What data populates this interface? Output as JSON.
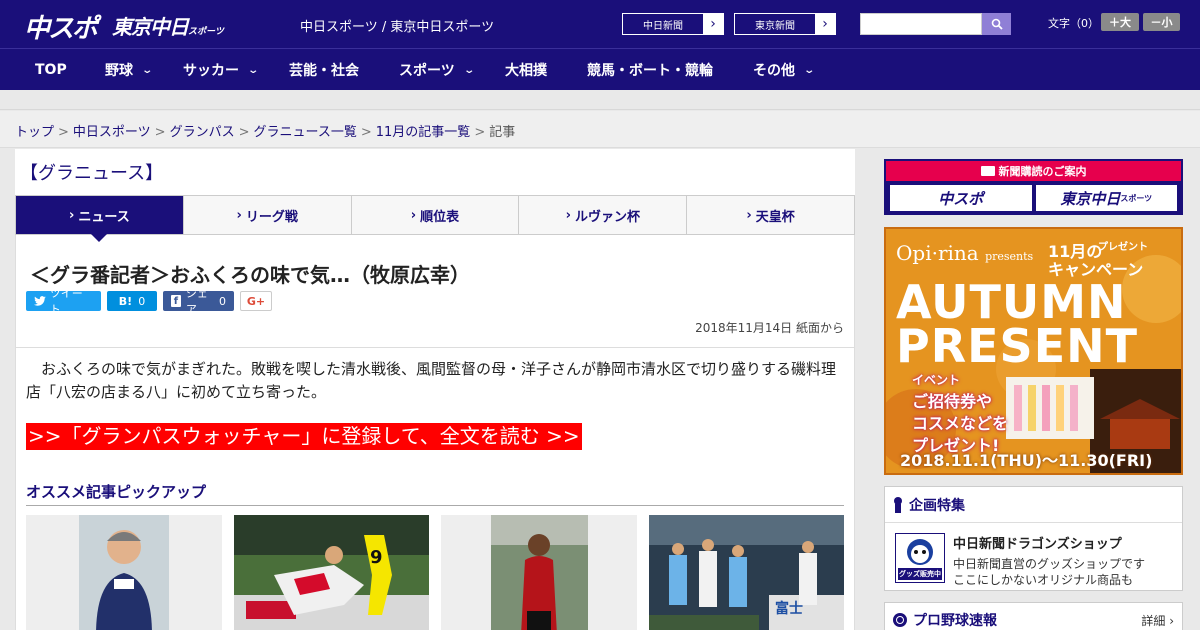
{
  "header": {
    "logo_chu": "中スポ",
    "logo_tokyo": "東京中日",
    "logo_tokyo_sub": "スポーツ",
    "tagline": "中日スポーツ / 東京中日スポーツ",
    "ext_links": [
      "中日新聞",
      "東京新聞"
    ],
    "search_placeholder": "",
    "font_size_label": "文字（0）",
    "font_up": "＋大",
    "font_down": "－小"
  },
  "nav": {
    "items": [
      {
        "label": "TOP",
        "dropdown": false
      },
      {
        "label": "野球",
        "dropdown": true
      },
      {
        "label": "サッカー",
        "dropdown": true
      },
      {
        "label": "芸能・社会",
        "dropdown": false
      },
      {
        "label": "スポーツ",
        "dropdown": true
      },
      {
        "label": "大相撲",
        "dropdown": false
      },
      {
        "label": "競馬・ボート・競輪",
        "dropdown": false
      },
      {
        "label": "その他",
        "dropdown": true
      }
    ]
  },
  "breadcrumb": {
    "items": [
      "トップ",
      "中日スポーツ",
      "グランパス",
      "グラニュース一覧",
      "11月の記事一覧"
    ],
    "current": "記事",
    "sep": ">"
  },
  "main": {
    "section_title": "【グラニュース】",
    "tabs": [
      "ニュース",
      "リーグ戦",
      "順位表",
      "ルヴァン杯",
      "天皇杯"
    ],
    "tab_marker": "›",
    "article": {
      "title": "＜グラ番記者＞おふくろの味で気…（牧原広幸）",
      "share": {
        "tweet": "ツイート",
        "hatena": "B!",
        "hatena_count": "0",
        "facebook": "シェア",
        "facebook_count": "0",
        "gplus": "G+"
      },
      "date": "2018年11月14日 紙面から",
      "lead": "おふくろの味で気がまぎれた。敗戦を喫した清水戦後、風間監督の母・洋子さんが静岡市清水区で切り盛りする磯料理店「八宏の店まる八」に初めて立ち寄った。",
      "cta": ">>「グランパスウォッチャー」に登録して、全文を読む >>"
    },
    "pickup_title": "オススメ記事ピックアップ"
  },
  "sidebar": {
    "subscribe_title": "新聞購読のご案内",
    "subscribe_chu": "中スポ",
    "subscribe_tokyo": "東京中日",
    "subscribe_tokyo_sub": "スポーツ",
    "ad": {
      "brand": "Opi·rina",
      "presents": "presents",
      "campaign_line1": "11月の",
      "campaign_line2": "キャンペーン",
      "campaign_small": "プレゼント",
      "big1": "AUTUMN",
      "big2": "PRESENT",
      "promo1": "イベント",
      "promo2": "ご招待券や",
      "promo3": "コスメなどを",
      "promo4": "プレゼント!",
      "period": "2018.11.1(THU)～11.30(FRI)"
    },
    "feature_title": "企画特集",
    "shop_title": "中日新聞ドラゴンズショップ",
    "shop_desc1": "中日新聞直営のグッズショップです",
    "shop_desc2": "ここにしかないオリジナル商品も",
    "shop_badge": "グッズ販売中",
    "baseball_title": "プロ野球速報",
    "baseball_more": "詳細 ›"
  },
  "colors": {
    "brand_navy": "#1a0f7a",
    "cta_red": "#ff0000",
    "subscribe_pink": "#e6004d",
    "twitter": "#1da1f2",
    "hatena": "#008fde",
    "facebook": "#3b5998"
  }
}
